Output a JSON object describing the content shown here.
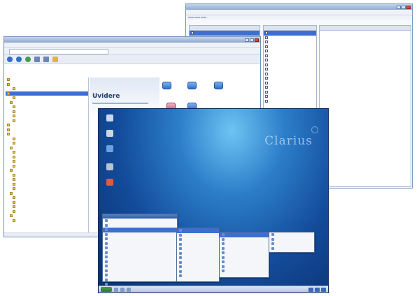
{
  "windows": {
    "properties": {
      "title": "",
      "menu": [
        "",
        "",
        ""
      ],
      "tabs": [
        "",
        "",
        ""
      ],
      "left_rows": 4,
      "mid_rows": [
        "",
        "",
        "",
        "",
        "",
        "",
        "",
        "",
        "",
        "",
        "",
        "",
        "",
        "",
        "",
        ""
      ],
      "right_lines": [
        "",
        "",
        "",
        "",
        "",
        ""
      ]
    },
    "explorer": {
      "title": "",
      "menu": [
        "",
        "",
        "",
        "",
        "",
        "",
        ""
      ],
      "content_title": "Uvidere",
      "tree_nodes": [
        "",
        "",
        "",
        "",
        "",
        "",
        "",
        "",
        "",
        "",
        "",
        "",
        "",
        "",
        "",
        "",
        "",
        "",
        "",
        "",
        "",
        "",
        "",
        "",
        "",
        "",
        "",
        "",
        "",
        "",
        "",
        ""
      ],
      "icons": [
        "",
        "",
        "",
        "",
        ""
      ]
    }
  },
  "desktop": {
    "logo": "Clarius",
    "desktop_icons": [
      "",
      "",
      "",
      "",
      ""
    ],
    "menus": {
      "start": [
        "",
        "",
        "",
        "",
        "",
        "",
        "",
        "",
        "",
        "",
        "",
        "",
        "",
        "",
        ""
      ],
      "sub1": [
        "",
        "",
        "",
        "",
        "",
        "",
        "",
        "",
        "",
        "",
        ""
      ],
      "sub2": [
        "",
        "",
        "",
        "",
        "",
        "",
        "",
        "",
        ""
      ],
      "sub3": [
        "",
        "",
        "",
        ""
      ]
    }
  },
  "colors": {
    "desktop_bg": "#1a5aa8",
    "titlebar": "#8fa9cf",
    "selection": "#3d6fd1"
  }
}
